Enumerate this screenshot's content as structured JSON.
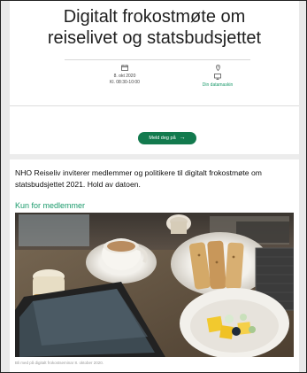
{
  "event": {
    "title_line1": "Digitalt frokostmøte om",
    "title_line2": "reiselivet og statsbudsjettet",
    "date": "8. okt 2020",
    "time": "Kl. 08:30-10:00",
    "location": "Din datamaskin",
    "signup_label": "Meld deg på",
    "intro": "NHO Reiseliv inviterer medlemmer og politikere til digitalt frokostmøte om statsbudsjettet 2021. Hold av datoen.",
    "section_heading": "Kun for medlemmer",
    "photo_caption": "Bli med på digitalt frokostseminar 8. oktober 2020."
  },
  "icons": {
    "date": "calendar-icon",
    "location": "map-pin-icon",
    "location_device": "monitor-icon",
    "signup": "arrow-right-icon"
  },
  "colors": {
    "accent_green": "#137a4e",
    "link_green": "#1a9a6b",
    "text": "#1f1f1f"
  }
}
